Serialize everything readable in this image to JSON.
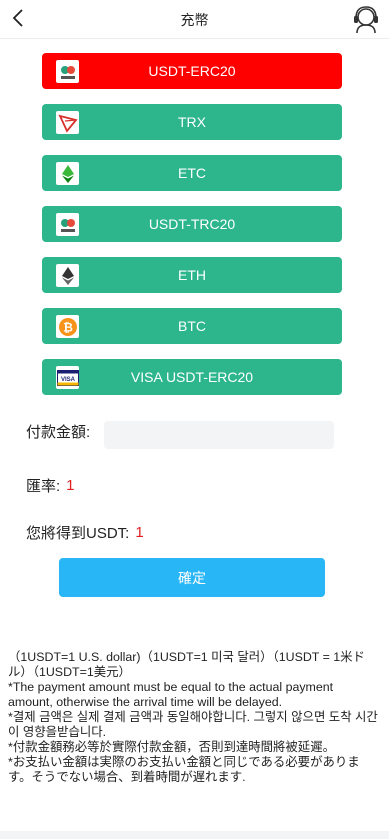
{
  "header": {
    "title": "充幣",
    "back_icon": "chevron-left-icon",
    "support_icon": "customer-service-icon"
  },
  "coins": [
    {
      "label": "USDT-ERC20",
      "icon": "usdt-icon",
      "active": true
    },
    {
      "label": "TRX",
      "icon": "tron-icon",
      "active": false
    },
    {
      "label": "ETC",
      "icon": "etc-icon",
      "active": false
    },
    {
      "label": "USDT-TRC20",
      "icon": "usdt-icon",
      "active": false
    },
    {
      "label": "ETH",
      "icon": "eth-icon",
      "active": false
    },
    {
      "label": "BTC",
      "icon": "btc-icon",
      "active": false
    },
    {
      "label": "VISA USDT-ERC20",
      "icon": "visa-icon",
      "active": false
    }
  ],
  "form": {
    "amount_label": "付款金額:",
    "amount_value": "",
    "rate_label": "匯率:",
    "rate_value": "1",
    "receive_label": "您將得到USDT:",
    "receive_value": "1",
    "confirm_label": "確定"
  },
  "notes": [
    "（1USDT=1 U.S. dollar)（1USDT=1 미국 달러）（1USDT = 1米ドル）（1USDT=1美元）",
    "*The payment amount must be equal to the actual payment amount, otherwise the arrival time will be delayed.",
    "*결제 금액은 실제 결제 금액과 동일해야합니다. 그렇지 않으면 도착 시간이 영향을받습니다.",
    "*付款金額務必等於實際付款金額，否則到達時間將被延遲。",
    "*お支払い金額は実際のお支払い金額と同じである必要があります。そうでない場合、到着時間が遅れます."
  ],
  "colors": {
    "active": "#ff0000",
    "coin": "#2db58c",
    "confirm": "#29b6f6",
    "highlight": "#e02020"
  }
}
